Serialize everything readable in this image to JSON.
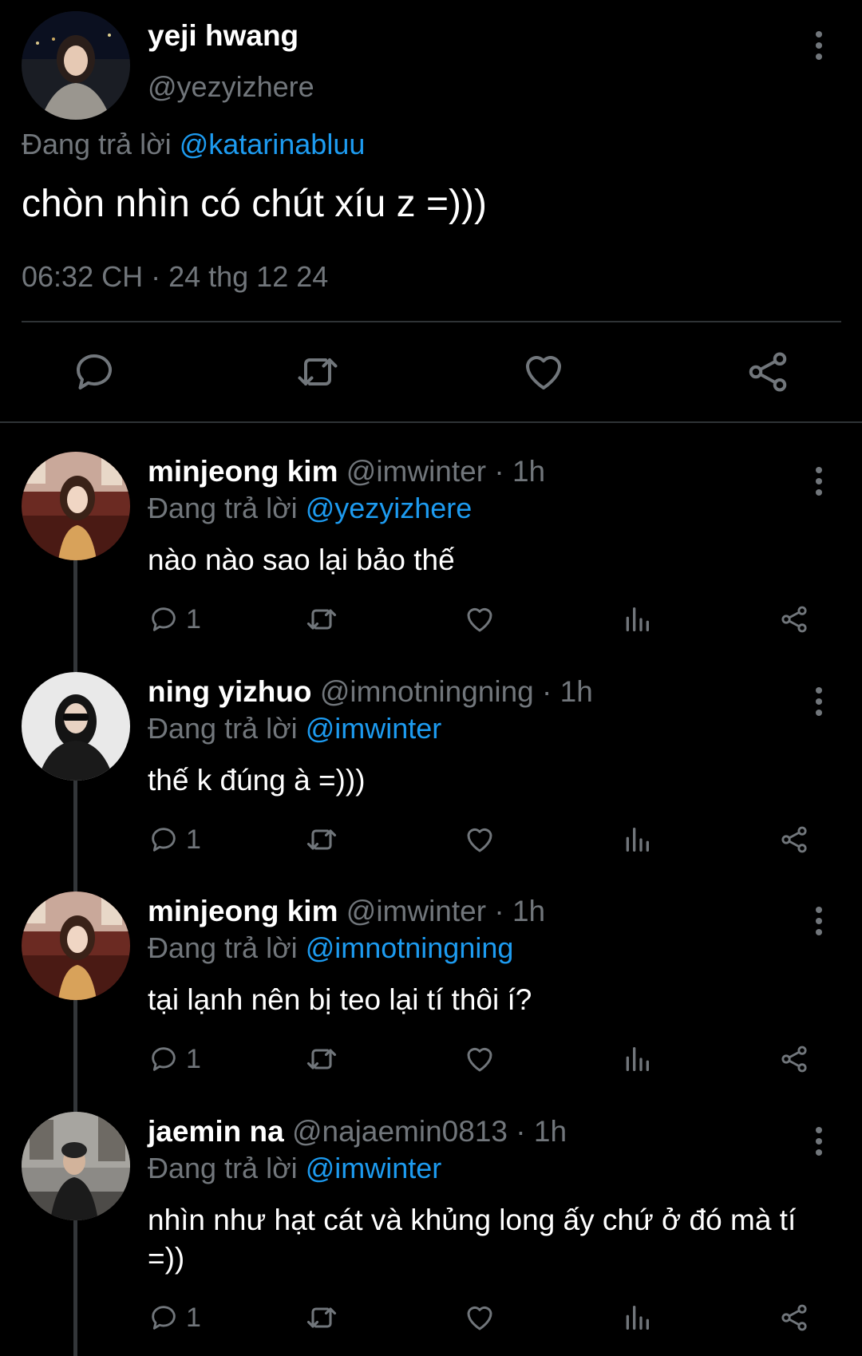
{
  "main_tweet": {
    "name": "yeji hwang",
    "handle": "@yezyizhere",
    "reply_prefix": "Đang trả lời ",
    "reply_to": "@katarinabluu",
    "text": "chòn nhìn có chút xíu z =)))",
    "timestamp": "06:32 CH · 24 thg 12 24"
  },
  "replies": [
    {
      "name": "minjeong kim",
      "handle": "@imwinter · 1h",
      "reply_prefix": "Đang trả lời ",
      "reply_to": "@yezyizhere",
      "text": "nào nào sao lại bảo thế",
      "reply_count": "1"
    },
    {
      "name": "ning yizhuo",
      "handle": "@imnotningning · 1h",
      "reply_prefix": "Đang trả lời ",
      "reply_to": "@imwinter",
      "text": "thế k đúng à =)))",
      "reply_count": "1"
    },
    {
      "name": "minjeong kim",
      "handle": "@imwinter · 1h",
      "reply_prefix": "Đang trả lời ",
      "reply_to": "@imnotningning",
      "text": "tại lạnh nên bị teo lại tí thôi í?",
      "reply_count": "1"
    },
    {
      "name": "jaemin na",
      "handle": "@najaemin0813 · 1h",
      "reply_prefix": "Đang trả lời ",
      "reply_to": "@imwinter",
      "text": "nhìn như hạt cát và khủng long ấy chứ ở đó mà tí =))",
      "reply_count": "1"
    }
  ],
  "icons": {
    "reply": "reply-icon",
    "retweet": "retweet-icon",
    "like": "heart-icon",
    "views": "views-icon",
    "share": "share-icon",
    "more": "more-vertical-icon"
  },
  "colors": {
    "background": "#000000",
    "text": "#ffffff",
    "secondary": "#71767b",
    "link": "#1d9bf0",
    "divider": "#2f3336"
  }
}
